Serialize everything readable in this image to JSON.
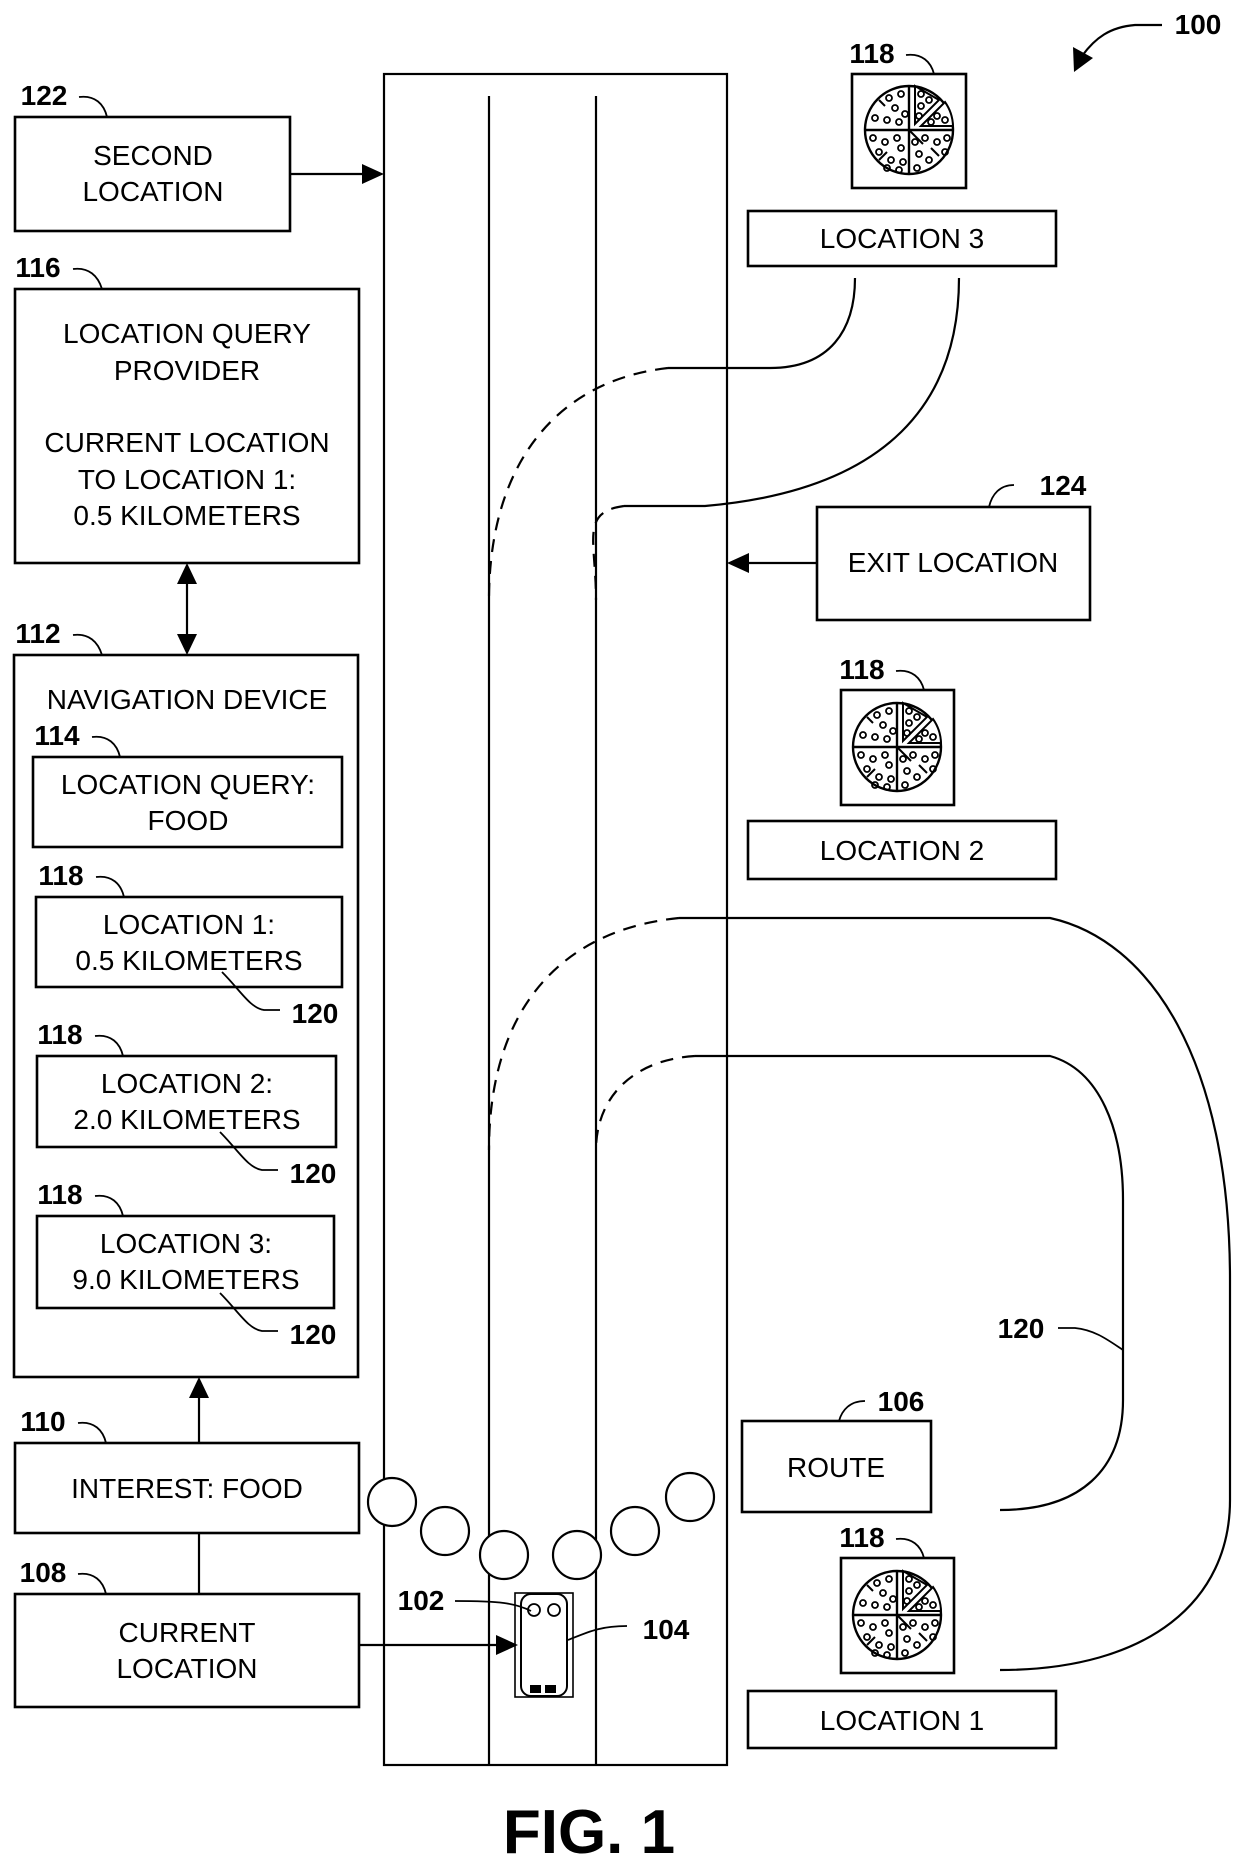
{
  "figure": {
    "label": "FIG. 1",
    "system_ref": "100"
  },
  "left_column": {
    "second_location": {
      "ref": "122",
      "lines": [
        "SECOND",
        "LOCATION"
      ]
    },
    "location_query_provider": {
      "ref": "116",
      "title_lines": [
        "LOCATION QUERY",
        "PROVIDER"
      ],
      "detail_lines": [
        "CURRENT LOCATION",
        "TO LOCATION 1:",
        "0.5 KILOMETERS"
      ]
    },
    "navigation_device": {
      "ref": "112",
      "title": "NAVIGATION DEVICE",
      "location_query": {
        "ref": "114",
        "lines": [
          "LOCATION QUERY:",
          "FOOD"
        ]
      },
      "results": [
        {
          "ref": "118",
          "distance_ref": "120",
          "lines": [
            "LOCATION 1:",
            "0.5 KILOMETERS"
          ]
        },
        {
          "ref": "118",
          "distance_ref": "120",
          "lines": [
            "LOCATION 2:",
            "2.0 KILOMETERS"
          ]
        },
        {
          "ref": "118",
          "distance_ref": "120",
          "lines": [
            "LOCATION 3:",
            "9.0 KILOMETERS"
          ]
        }
      ]
    },
    "interest": {
      "ref": "110",
      "label": "INTEREST: FOOD"
    },
    "current_location": {
      "ref": "108",
      "lines": [
        "CURRENT",
        "LOCATION"
      ]
    }
  },
  "road": {
    "vehicle_ref": "104",
    "occupants_ref": "102"
  },
  "right_column": {
    "location3": {
      "icon_ref": "118",
      "icon": "pizza-icon",
      "label": "LOCATION 3"
    },
    "exit_location": {
      "ref": "124",
      "label": "EXIT LOCATION"
    },
    "location2": {
      "icon_ref": "118",
      "icon": "pizza-icon",
      "label": "LOCATION 2"
    },
    "route_distance_ref": "120",
    "route": {
      "ref": "106",
      "label": "ROUTE"
    },
    "location1": {
      "icon_ref": "118",
      "icon": "pizza-icon",
      "label": "LOCATION 1"
    }
  }
}
